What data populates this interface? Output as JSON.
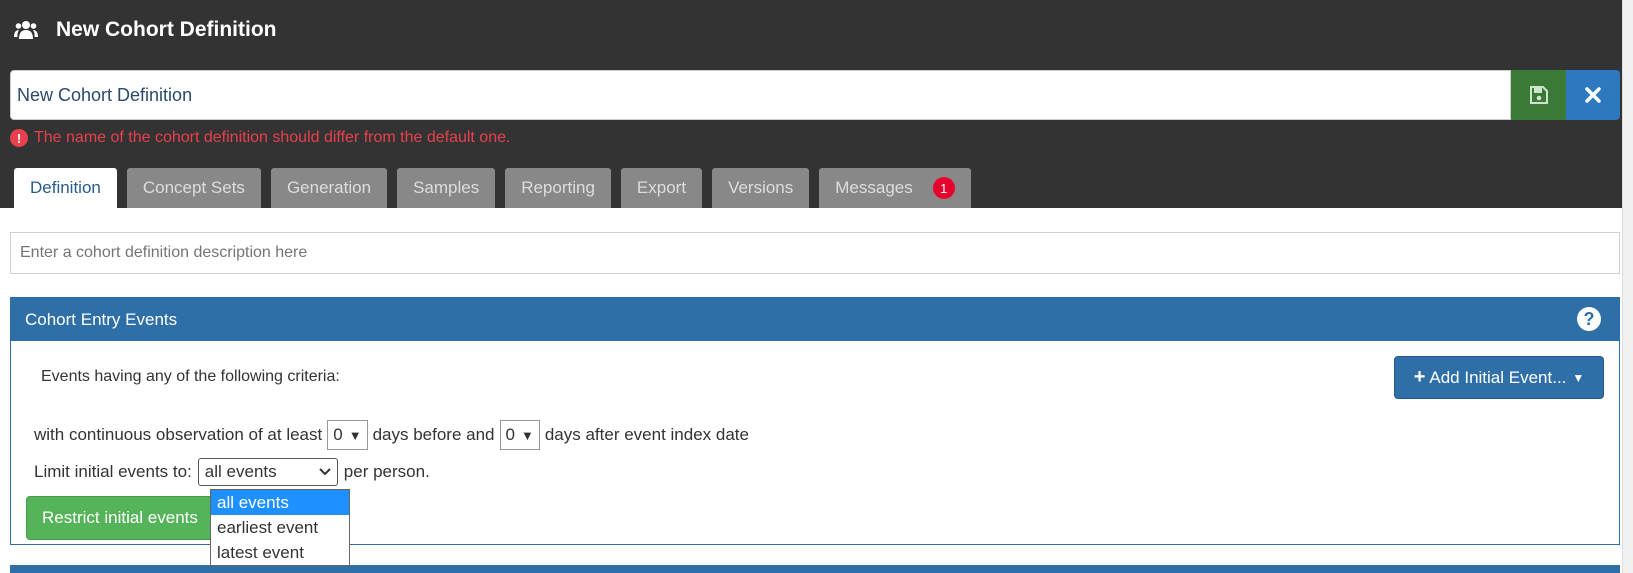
{
  "header": {
    "title": "New Cohort Definition",
    "icon": "users-icon"
  },
  "name_field": {
    "value": "New Cohort Definition"
  },
  "warning": {
    "icon": "exclamation-circle-icon",
    "text": "The name of the cohort definition should differ from the default one."
  },
  "tabs": [
    {
      "label": "Definition",
      "active": true
    },
    {
      "label": "Concept Sets"
    },
    {
      "label": "Generation"
    },
    {
      "label": "Samples"
    },
    {
      "label": "Reporting"
    },
    {
      "label": "Export"
    },
    {
      "label": "Versions"
    },
    {
      "label": "Messages",
      "badge": "1"
    }
  ],
  "description": {
    "placeholder": "Enter a cohort definition description here"
  },
  "entry_events": {
    "title": "Cohort Entry Events",
    "help_icon": "?",
    "criteria_label": "Events having any of the following criteria:",
    "add_button": "Add Initial Event...",
    "obs_prefix": "with continuous observation of at least",
    "days_before_value": "0",
    "obs_mid": "days before and",
    "days_after_value": "0",
    "obs_suffix": "days after event index date",
    "limit_label": "Limit initial events to:",
    "limit_value": "all events",
    "limit_suffix": "per person.",
    "limit_options": [
      "all events",
      "earliest event",
      "latest event"
    ],
    "restrict_button": "Restrict initial events"
  },
  "colors": {
    "header_bg": "#333333",
    "primary": "#2e6fa8",
    "success": "#55b359",
    "save_green": "#3a7a36",
    "danger": "#e8404c"
  }
}
